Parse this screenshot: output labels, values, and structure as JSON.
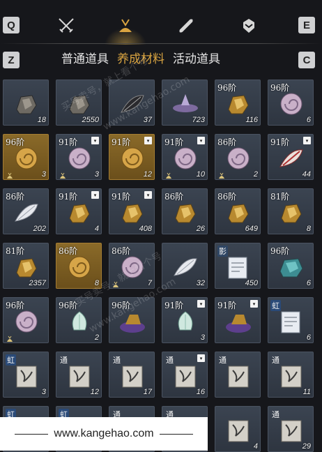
{
  "keys": {
    "left_top": "Q",
    "right_top": "E",
    "left_sub": "Z",
    "right_sub": "C"
  },
  "top_tabs": [
    {
      "name": "swords-icon"
    },
    {
      "name": "material-bag-icon",
      "active": true
    },
    {
      "name": "scroll-icon"
    },
    {
      "name": "gem-icon"
    }
  ],
  "subtabs": [
    "普通道具",
    "养成材料",
    "活动道具"
  ],
  "active_subtab": 1,
  "items": [
    {
      "art": "ore-dark",
      "tier": "",
      "count": "18",
      "badge": false,
      "gold": false
    },
    {
      "art": "ore-dark",
      "tier": "",
      "count": "2550",
      "badge": false,
      "gold": false
    },
    {
      "art": "feather-dark",
      "tier": "",
      "count": "37",
      "badge": false,
      "gold": false
    },
    {
      "art": "mirror",
      "tier": "",
      "count": "723",
      "badge": false,
      "gold": false
    },
    {
      "art": "ore-gold",
      "tier": "96阶",
      "count": "116",
      "badge": false,
      "gold": false
    },
    {
      "art": "shell-pink",
      "tier": "96阶",
      "count": "6",
      "badge": false,
      "gold": false
    },
    {
      "art": "shell-gold",
      "tier": "96阶",
      "count": "3",
      "badge": false,
      "gold": true,
      "bag": true
    },
    {
      "art": "shell-pink",
      "tier": "91阶",
      "count": "3",
      "badge": true,
      "gold": false,
      "bag": true
    },
    {
      "art": "shell-gold",
      "tier": "91阶",
      "count": "12",
      "badge": true,
      "gold": true
    },
    {
      "art": "shell-pink",
      "tier": "91阶",
      "count": "10",
      "badge": true,
      "gold": false,
      "bag": true
    },
    {
      "art": "shell-pink",
      "tier": "86阶",
      "count": "2",
      "badge": false,
      "gold": false,
      "bag": true
    },
    {
      "art": "feather-red",
      "tier": "91阶",
      "count": "44",
      "badge": true,
      "gold": false
    },
    {
      "art": "feather-white",
      "tier": "86阶",
      "count": "202",
      "badge": false,
      "gold": false
    },
    {
      "art": "ore-gold",
      "tier": "91阶",
      "count": "4",
      "badge": true,
      "gold": false
    },
    {
      "art": "ore-gold",
      "tier": "91阶",
      "count": "408",
      "badge": true,
      "gold": false
    },
    {
      "art": "ore-gold",
      "tier": "86阶",
      "count": "26",
      "badge": false,
      "gold": false
    },
    {
      "art": "ore-gold",
      "tier": "86阶",
      "count": "649",
      "badge": false,
      "gold": false
    },
    {
      "art": "ore-gold",
      "tier": "81阶",
      "count": "8",
      "badge": false,
      "gold": false
    },
    {
      "art": "ore-gold",
      "tier": "81阶",
      "count": "2357",
      "badge": false,
      "gold": false
    },
    {
      "art": "shell-gold",
      "tier": "86阶",
      "count": "8",
      "badge": false,
      "gold": true
    },
    {
      "art": "shell-pink",
      "tier": "86阶",
      "count": "7",
      "badge": false,
      "gold": false,
      "bag": true
    },
    {
      "art": "feather-white",
      "tier": "",
      "count": "32",
      "badge": false,
      "gold": false
    },
    {
      "art": "letter",
      "tier": "",
      "count": "450",
      "badge": false,
      "gold": false,
      "tag": "影",
      "tagClass": "shadow"
    },
    {
      "art": "ore-teal",
      "tier": "96阶",
      "count": "6",
      "badge": false,
      "gold": false
    },
    {
      "art": "shell-pink",
      "tier": "96阶",
      "count": "",
      "badge": false,
      "gold": false,
      "bag": true
    },
    {
      "art": "lotus",
      "tier": "96阶",
      "count": "2",
      "badge": false,
      "gold": false
    },
    {
      "art": "ore-purple",
      "tier": "96阶",
      "count": "",
      "badge": false,
      "gold": false
    },
    {
      "art": "lotus",
      "tier": "91阶",
      "count": "3",
      "badge": true,
      "gold": false
    },
    {
      "art": "ore-purple",
      "tier": "91阶",
      "count": "",
      "badge": true,
      "gold": false
    },
    {
      "art": "letter",
      "tier": "",
      "count": "6",
      "badge": false,
      "gold": false,
      "tag": "虹",
      "tagClass": "rainbow"
    },
    {
      "art": "book",
      "tier": "",
      "count": "3",
      "badge": false,
      "gold": false,
      "tag": "虹",
      "tagClass": "rainbow"
    },
    {
      "art": "book",
      "tier": "",
      "count": "12",
      "badge": false,
      "gold": false,
      "tag": "通",
      "tagClass": "common"
    },
    {
      "art": "book",
      "tier": "",
      "count": "17",
      "badge": false,
      "gold": false,
      "tag": "通",
      "tagClass": "common"
    },
    {
      "art": "book",
      "tier": "",
      "count": "16",
      "badge": true,
      "gold": false,
      "tag": "通",
      "tagClass": "common"
    },
    {
      "art": "book",
      "tier": "",
      "count": "",
      "badge": false,
      "gold": false,
      "tag": "通",
      "tagClass": "common"
    },
    {
      "art": "book",
      "tier": "",
      "count": "11",
      "badge": false,
      "gold": false,
      "tag": "通",
      "tagClass": "common"
    },
    {
      "art": "book",
      "tier": "",
      "count": "",
      "badge": false,
      "gold": false,
      "tag": "虹",
      "tagClass": "rainbow"
    },
    {
      "art": "book",
      "tier": "",
      "count": "",
      "badge": false,
      "gold": false,
      "tag": "虹",
      "tagClass": "rainbow"
    },
    {
      "art": "book",
      "tier": "",
      "count": "",
      "badge": false,
      "gold": false,
      "tag": "通",
      "tagClass": "common"
    },
    {
      "art": "book",
      "tier": "",
      "count": "",
      "badge": false,
      "gold": false,
      "tag": "通",
      "tagClass": "common"
    },
    {
      "art": "book",
      "tier": "",
      "count": "4",
      "badge": false,
      "gold": false
    },
    {
      "art": "book",
      "tier": "",
      "count": "29",
      "badge": false,
      "gold": false,
      "tag": "通",
      "tagClass": "common"
    }
  ],
  "badge_glyph": "▾",
  "footer": {
    "url": "www.kangehao.com"
  },
  "watermarks": [
    "买号卖号，就上看个号",
    "www.kangehao.com",
    "买号卖号，就上看个号",
    "www.kangehao.com"
  ],
  "colors": {
    "accent": "#d9a441",
    "slot": "#343c48",
    "gold_slot": "#7a5c22"
  }
}
